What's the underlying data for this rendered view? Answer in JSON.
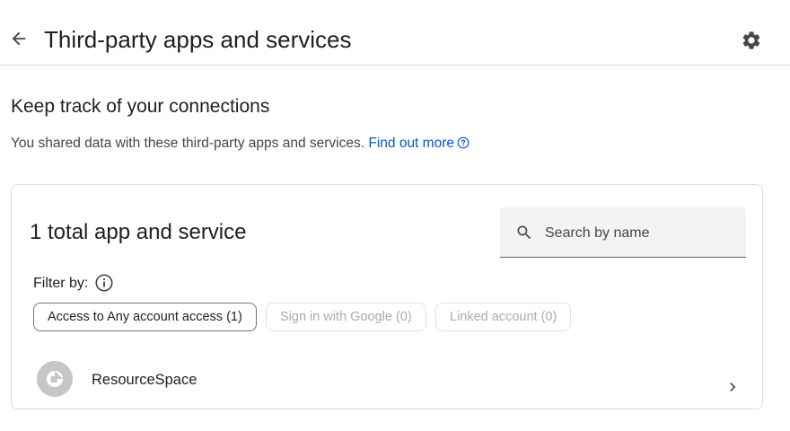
{
  "header": {
    "title": "Third-party apps and services",
    "back_icon": "arrow-back-icon",
    "settings_icon": "gear-icon"
  },
  "section": {
    "heading": "Keep track of your connections",
    "description": "You shared data with these third-party apps and services.",
    "link_text": "Find out more",
    "link_icon": "help-circle-icon"
  },
  "card": {
    "total_label": "1 total app and service",
    "search": {
      "placeholder": "Search by name",
      "value": ""
    },
    "filter_label": "Filter by:",
    "filters": [
      {
        "label": "Access to Any account access (1)",
        "selected": true,
        "enabled": true
      },
      {
        "label": "Sign in with Google (0)",
        "selected": false,
        "enabled": false
      },
      {
        "label": "Linked account (0)",
        "selected": false,
        "enabled": false
      }
    ],
    "apps": [
      {
        "name": "ResourceSpace",
        "icon": "app-placeholder-icon"
      }
    ]
  },
  "colors": {
    "link": "#0b57d0",
    "text_primary": "#1f1f1f",
    "text_secondary": "#444746",
    "border": "#dadce0",
    "search_bg": "#f1f3f4",
    "chip_disabled_text": "#a8abad"
  }
}
